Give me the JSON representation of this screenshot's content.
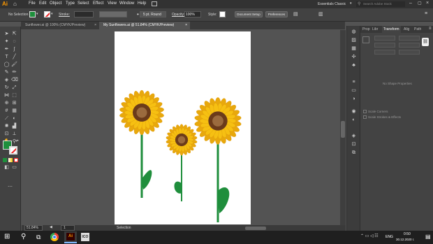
{
  "app": {
    "logo": "Ai",
    "workspace": "Essentials Classic",
    "search_placeholder": "Search Adobe Stock"
  },
  "menus": [
    "File",
    "Edit",
    "Object",
    "Type",
    "Select",
    "Effect",
    "View",
    "Window",
    "Help"
  ],
  "control": {
    "selection": "No Selection",
    "stroke_label": "Stroke:",
    "brush": "5 pt. Round",
    "opacity_label": "Opacity:",
    "opacity_value": "100%",
    "style_label": "Style:",
    "document_setup": "Document Setup",
    "preferences": "Preferences",
    "fill_color": "#1e8f3c"
  },
  "tabs": [
    {
      "label": "Sunflower.ai @ 100% (CMYK/Preview)",
      "active": false
    },
    {
      "label": "My Sunflowers.ai @ 51.84% (CMYK/Preview)",
      "active": true
    }
  ],
  "status": {
    "zoom": "51.84%",
    "page": "1",
    "tool": "Selection"
  },
  "panel": {
    "tabs": [
      "Prop",
      "Libr",
      "Transform",
      "Alig",
      "Path"
    ],
    "active_tab": "Transform",
    "empty_text": "No Shape Properties",
    "checkbox1": "Scale Corners",
    "checkbox2": "Scale Strokes & Effects"
  },
  "taskbar": {
    "language": "ENG",
    "time": "0:50",
    "date": "30.12.2020 г."
  },
  "colors": {
    "petal": "#f6c012",
    "petal_dark": "#e8a80c",
    "center": "#6b3b1a",
    "center_inner": "#9b6b3e",
    "stem": "#1f8e3c"
  }
}
